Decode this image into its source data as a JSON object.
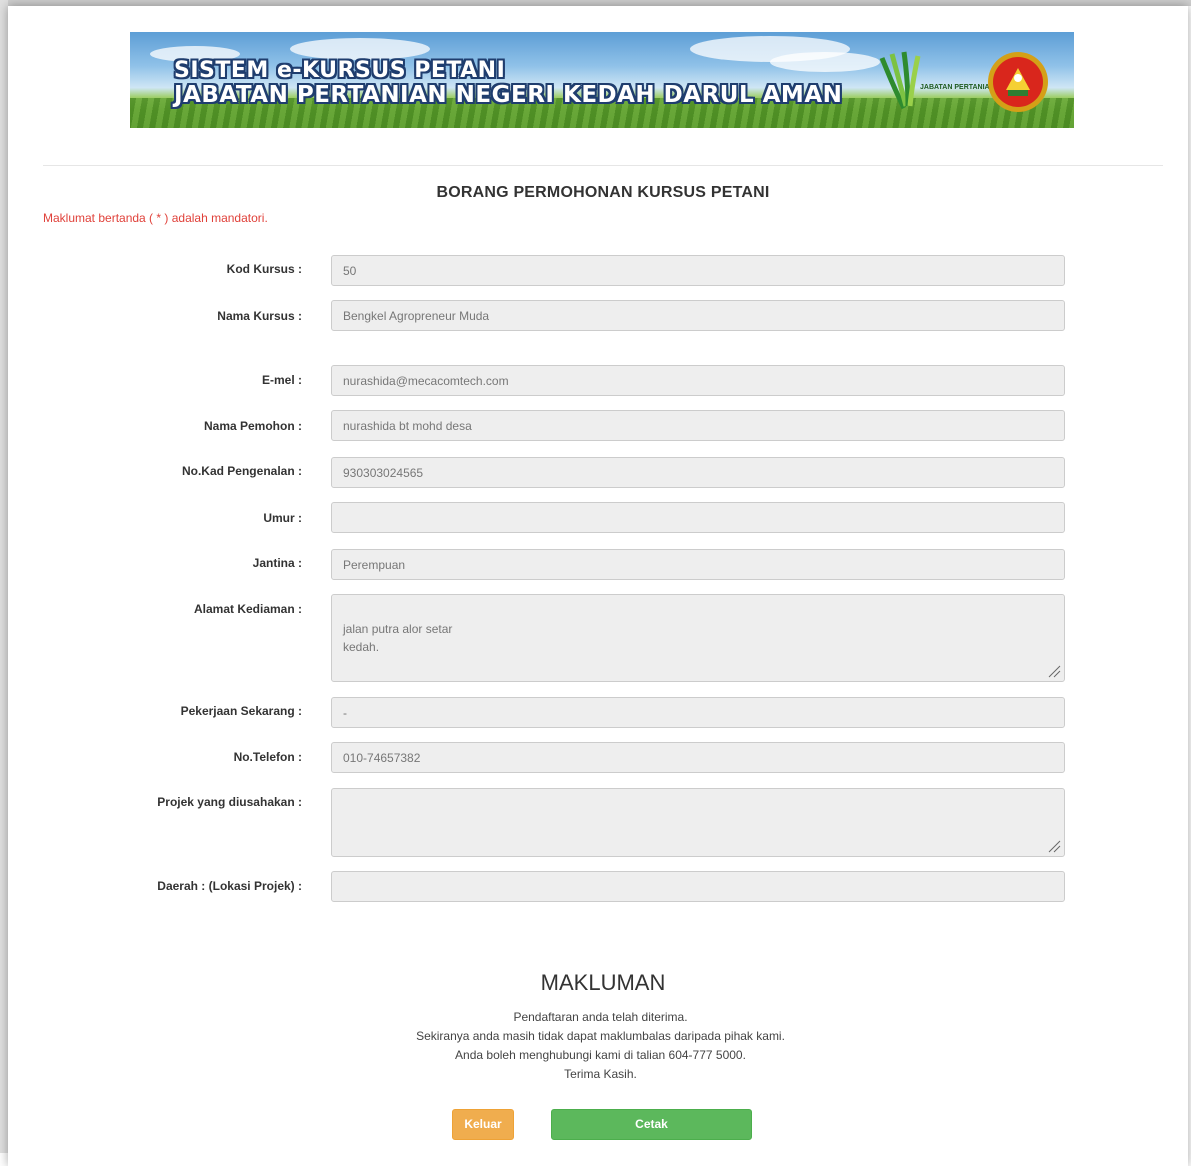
{
  "banner": {
    "title_line1": "SISTEM e-KURSUS PETANI",
    "title_line2": "JABATAN PERTANIAN NEGERI KEDAH DARUL AMAN",
    "logo_text": "JABATAN PERTANIAN"
  },
  "form": {
    "title": "BORANG PERMOHONAN KURSUS PETANI",
    "mandatory_note": "Maklumat bertanda ( * ) adalah mandatori.",
    "fields": [
      {
        "label": "Kod Kursus :",
        "value": "50"
      },
      {
        "label": "Nama Kursus :",
        "value": "Bengkel Agropreneur Muda"
      },
      {
        "label": "E-mel :",
        "value": "nurashida@mecacomtech.com"
      },
      {
        "label": "Nama Pemohon :",
        "value": "nurashida bt mohd desa"
      },
      {
        "label": "No.Kad Pengenalan :",
        "value": "930303024565"
      },
      {
        "label": "Umur :",
        "value": ""
      },
      {
        "label": "Jantina :",
        "value": "Perempuan"
      },
      {
        "label": "Alamat Kediaman :",
        "value": "jalan putra alor setar\nkedah."
      },
      {
        "label": "Pekerjaan Sekarang :",
        "value": "-"
      },
      {
        "label": "No.Telefon :",
        "value": "010-74657382"
      },
      {
        "label": "Projek yang diusahakan :",
        "value": ""
      },
      {
        "label": "Daerah : (Lokasi Projek) :",
        "value": ""
      }
    ]
  },
  "makluman": {
    "title": "MAKLUMAN",
    "lines": [
      "Pendaftaran anda telah diterima.",
      "Sekiranya anda masih tidak dapat maklumbalas daripada pihak kami.",
      "Anda boleh menghubungi kami di talian 604-777 5000.",
      "Terima Kasih."
    ]
  },
  "buttons": {
    "keluar": "Keluar",
    "cetak": "Cetak"
  },
  "colors": {
    "mandatory_red": "#e0413a",
    "keluar_orange": "#f0ad4e",
    "cetak_green": "#5cb85c"
  }
}
